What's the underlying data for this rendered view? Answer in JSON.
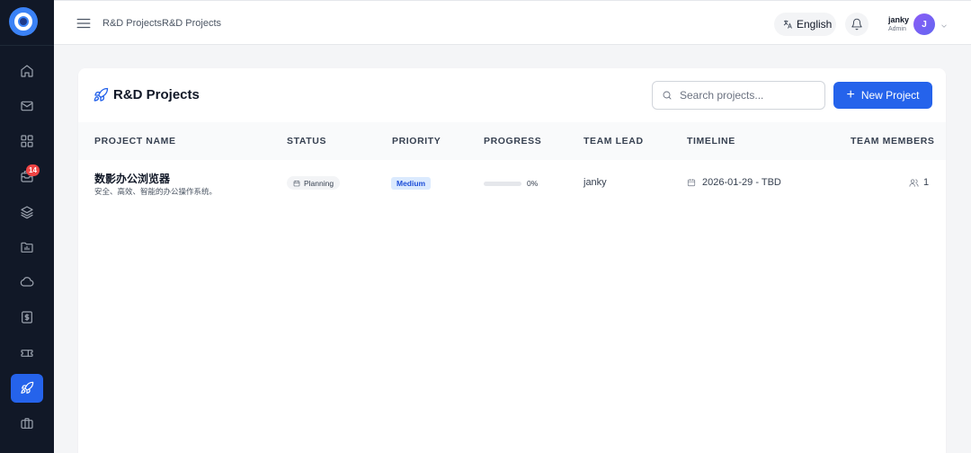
{
  "sidebar": {
    "items": [
      {
        "icon": "home-icon"
      },
      {
        "icon": "mail-icon"
      },
      {
        "icon": "grid-icon"
      },
      {
        "icon": "inbox-icon",
        "badge": "14"
      },
      {
        "icon": "layers-icon"
      },
      {
        "icon": "chart-folder-icon"
      },
      {
        "icon": "cloud-icon"
      },
      {
        "icon": "dollar-icon"
      },
      {
        "icon": "ticket-icon"
      },
      {
        "icon": "rocket-icon",
        "active": true
      },
      {
        "icon": "briefcase-icon"
      }
    ]
  },
  "header": {
    "breadcrumb": "R&D ProjectsR&D Projects",
    "language": "English",
    "user_name": "janky",
    "user_role": "Admin",
    "avatar_initial": "J"
  },
  "page": {
    "title": "R&D Projects",
    "search_placeholder": "Search projects...",
    "new_button": "New Project"
  },
  "table": {
    "columns": [
      "PROJECT NAME",
      "STATUS",
      "PRIORITY",
      "PROGRESS",
      "TEAM LEAD",
      "TIMELINE",
      "TEAM MEMBERS"
    ],
    "rows": [
      {
        "name": "数影办公浏览器",
        "description": "安全、高效、智能的办公操作系统。",
        "status": "Planning",
        "priority": "Medium",
        "progress": "0%",
        "progress_value": 0,
        "lead": "janky",
        "timeline": "2026-01-29 - TBD",
        "members": "1"
      }
    ]
  },
  "colors": {
    "accent": "#2563eb",
    "sidebar_bg": "#111827",
    "badge": "#ef4444"
  }
}
